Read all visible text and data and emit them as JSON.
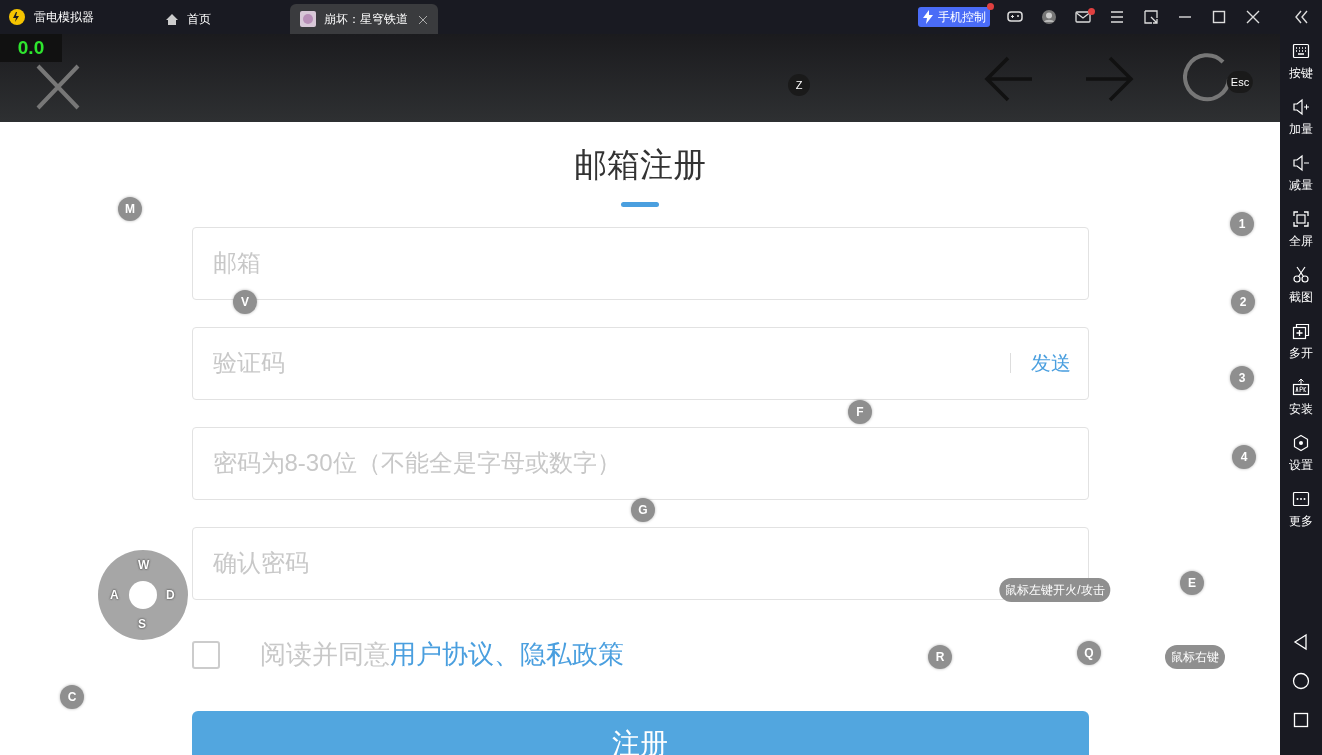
{
  "titlebar": {
    "app_name": "雷电模拟器",
    "home_label": "首页",
    "tabs": [
      {
        "label": "崩坏：星穹铁道",
        "selected": true
      }
    ],
    "phone_control": {
      "label": "手机控制",
      "notification": true
    },
    "icons": [
      {
        "kind": "gamepad",
        "notification": false
      },
      {
        "kind": "avatar",
        "notification": false
      },
      {
        "kind": "mail",
        "notification": true
      },
      {
        "kind": "menu",
        "notification": false
      },
      {
        "kind": "shrink",
        "notification": false
      },
      {
        "kind": "minimize",
        "notification": false
      },
      {
        "kind": "maximize",
        "notification": false
      },
      {
        "kind": "close",
        "notification": false
      },
      {
        "kind": "collapse",
        "notification": false
      }
    ]
  },
  "sidebar": {
    "items": [
      {
        "kind": "keyboard",
        "label": "按键"
      },
      {
        "kind": "volume-up",
        "label": "加量"
      },
      {
        "kind": "volume-down",
        "label": "减量"
      },
      {
        "kind": "fullscreen",
        "label": "全屏"
      },
      {
        "kind": "scissors",
        "label": "截图"
      },
      {
        "kind": "multi",
        "label": "多开"
      },
      {
        "kind": "apk",
        "label": "安装"
      },
      {
        "kind": "settings",
        "label": "设置"
      },
      {
        "kind": "more",
        "label": "更多"
      }
    ],
    "nav": [
      {
        "kind": "back"
      },
      {
        "kind": "home"
      },
      {
        "kind": "recent"
      }
    ]
  },
  "game": {
    "fps": "0.0",
    "form": {
      "title": "邮箱注册",
      "fields": [
        {
          "placeholder": "邮箱"
        },
        {
          "placeholder": "验证码",
          "action": "发送"
        },
        {
          "placeholder": "密码为8-30位（不能全是字母或数字）"
        },
        {
          "placeholder": "确认密码"
        }
      ],
      "agreement": {
        "checked": false,
        "prefix": "阅读并同意",
        "links": [
          "用户协议",
          "隐私政策"
        ],
        "separator": "、"
      },
      "submit": "注册"
    }
  },
  "key_overlay": {
    "keys": [
      {
        "kind": "dark",
        "label": "Z"
      },
      {
        "kind": "dark",
        "label": "Esc"
      },
      {
        "kind": "round",
        "label": "M"
      },
      {
        "kind": "round",
        "label": "1"
      },
      {
        "kind": "round",
        "label": "V"
      },
      {
        "kind": "round",
        "label": "2"
      },
      {
        "kind": "round",
        "label": "3"
      },
      {
        "kind": "round",
        "label": "F"
      },
      {
        "kind": "round",
        "label": "4"
      },
      {
        "kind": "round",
        "label": "G"
      },
      {
        "kind": "round",
        "label": "E"
      },
      {
        "kind": "pill",
        "label": "鼠标左键开火/攻击"
      },
      {
        "kind": "round",
        "label": "R"
      },
      {
        "kind": "round",
        "label": "Q"
      },
      {
        "kind": "pill",
        "label": "鼠标右键"
      },
      {
        "kind": "round",
        "label": "C"
      }
    ],
    "joystick": {
      "up": "W",
      "left": "A",
      "right": "D",
      "down": "S"
    }
  }
}
